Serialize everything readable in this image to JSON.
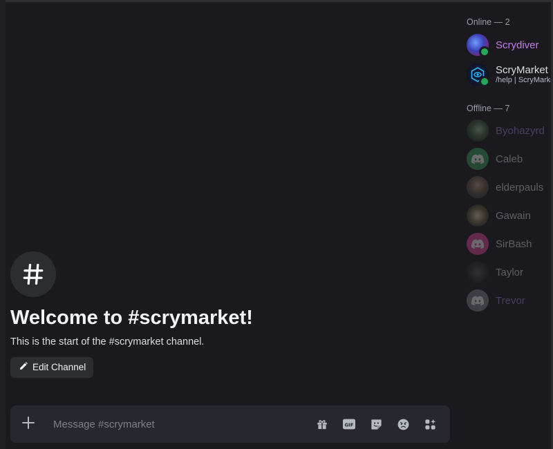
{
  "welcome": {
    "title": "Welcome to #scrymarket!",
    "subtitle": "This is the start of the #scrymarket channel.",
    "edit_label": "Edit Channel"
  },
  "composer": {
    "placeholder": "Message #scrymarket",
    "icons": [
      "gift-icon",
      "gif-icon",
      "sticker-icon",
      "emoji-icon",
      "apps-icon"
    ]
  },
  "members": {
    "online_header": "Online — 2",
    "offline_header": "Offline — 7",
    "online": [
      {
        "name": "Scrydiver",
        "color": "#c27ee6"
      },
      {
        "name": "ScryMarket",
        "status": "/help | ScryMarket",
        "color": "#dbdee1"
      }
    ],
    "offline": [
      {
        "name": "Byohazyrd",
        "color": "#a97fd6"
      },
      {
        "name": "Caleb",
        "color": "#dbdee1"
      },
      {
        "name": "elderpauls",
        "color": "#dbdee1"
      },
      {
        "name": "Gawain",
        "color": "#dbdee1"
      },
      {
        "name": "SirBash",
        "color": "#dbdee1"
      },
      {
        "name": "Taylor",
        "color": "#dbdee1"
      },
      {
        "name": "Trevor",
        "color": "#a97fd6"
      }
    ]
  }
}
